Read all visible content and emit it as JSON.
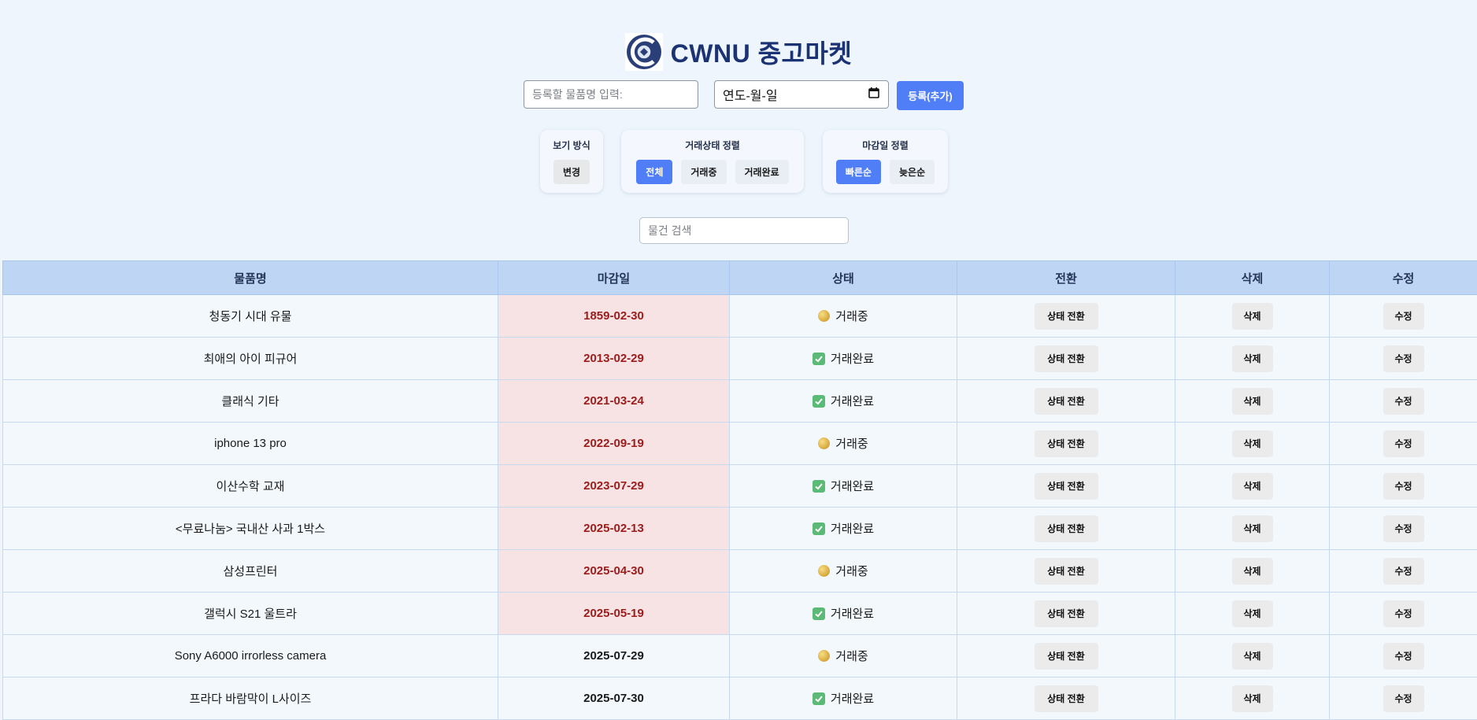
{
  "app": {
    "title": "CWNU 중고마켓"
  },
  "register": {
    "item_placeholder": "등록할 물품명 입력:",
    "date_placeholder": "연도-월-일",
    "submit_label": "등록(추가)"
  },
  "view_panel": {
    "title": "보기 방식",
    "button_label": "변경"
  },
  "status_panel": {
    "title": "거래상태 정렬",
    "options": [
      "전체",
      "거래중",
      "거래완료"
    ],
    "active": "전체"
  },
  "deadline_panel": {
    "title": "마감일 정렬",
    "options": [
      "빠른순",
      "늦은순"
    ],
    "active": "빠른순"
  },
  "search": {
    "placeholder": "물건 검색"
  },
  "table": {
    "headers": [
      "물품명",
      "마감일",
      "상태",
      "전환",
      "삭제",
      "수정"
    ],
    "toggle_label": "상태 전환",
    "delete_label": "삭제",
    "edit_label": "수정",
    "rows": [
      {
        "name": "청동기 시대 유물",
        "deadline": "1859-02-30",
        "status": "거래중",
        "status_icon": "coin-dot-icon",
        "overdue": true
      },
      {
        "name": "최애의 아이 피규어",
        "deadline": "2013-02-29",
        "status": "거래완료",
        "status_icon": "checkmark-icon",
        "overdue": true
      },
      {
        "name": "클래식 기타",
        "deadline": "2021-03-24",
        "status": "거래완료",
        "status_icon": "checkmark-icon",
        "overdue": true
      },
      {
        "name": "iphone 13 pro",
        "deadline": "2022-09-19",
        "status": "거래중",
        "status_icon": "coin-dot-icon",
        "overdue": true
      },
      {
        "name": "이산수학 교재",
        "deadline": "2023-07-29",
        "status": "거래완료",
        "status_icon": "checkmark-icon",
        "overdue": true
      },
      {
        "name": "<무료나눔> 국내산 사과 1박스",
        "deadline": "2025-02-13",
        "status": "거래완료",
        "status_icon": "checkmark-icon",
        "overdue": true
      },
      {
        "name": "삼성프린터",
        "deadline": "2025-04-30",
        "status": "거래중",
        "status_icon": "coin-dot-icon",
        "overdue": true
      },
      {
        "name": "갤럭시 S21 울트라",
        "deadline": "2025-05-19",
        "status": "거래완료",
        "status_icon": "checkmark-icon",
        "overdue": true
      },
      {
        "name": "Sony A6000 irrorless camera",
        "deadline": "2025-07-29",
        "status": "거래중",
        "status_icon": "coin-dot-icon",
        "overdue": false
      },
      {
        "name": "프라다 바람막이 L사이즈",
        "deadline": "2025-07-30",
        "status": "거래완료",
        "status_icon": "checkmark-icon",
        "overdue": false
      }
    ]
  },
  "colors": {
    "background": "#eef5fd",
    "accent": "#4f7ef7",
    "title": "#1c3373",
    "header_row": "#bed6f4",
    "overdue_bg": "#f7e3e4",
    "overdue_text": "#9c1c1c"
  }
}
